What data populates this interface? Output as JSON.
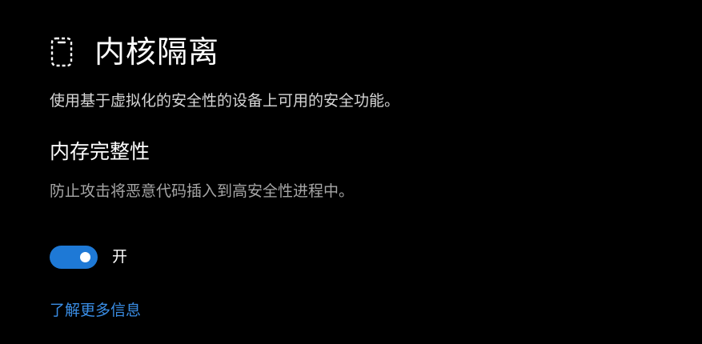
{
  "header": {
    "icon": "device-isolation-icon",
    "title": "内核隔离"
  },
  "description": "使用基于虚拟化的安全性的设备上可用的安全功能。",
  "memory_integrity": {
    "title": "内存完整性",
    "description": "防止攻击将恶意代码插入到高安全性进程中。",
    "toggle": {
      "state": "on",
      "label": "开",
      "color": "#1e79d6"
    }
  },
  "learn_more_link": "了解更多信息",
  "colors": {
    "background": "#000000",
    "link": "#3a8ee6"
  }
}
